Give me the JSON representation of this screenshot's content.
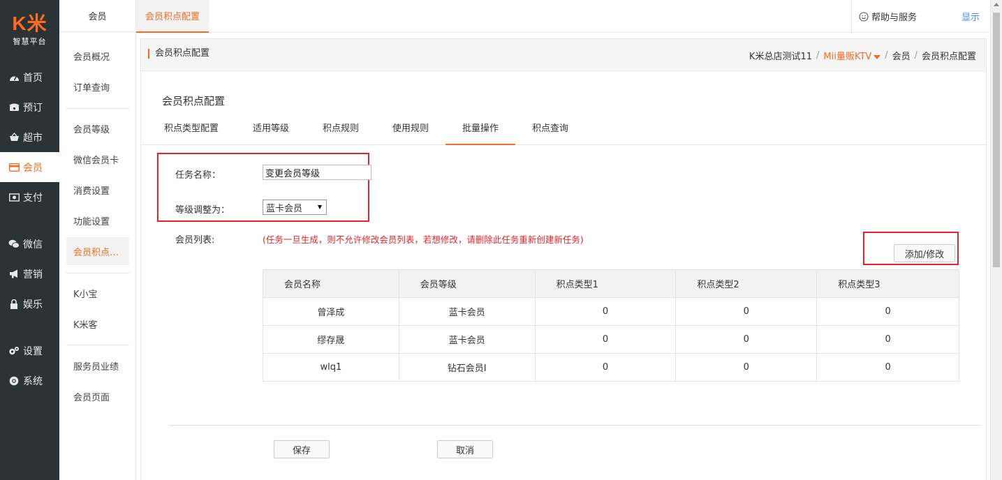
{
  "logo": {
    "mark": "K米",
    "sub": "智慧平台"
  },
  "main_nav": [
    {
      "label": "首页",
      "icon": "dashboard-icon"
    },
    {
      "label": "预订",
      "icon": "phone-icon"
    },
    {
      "label": "超市",
      "icon": "basket-icon"
    },
    {
      "label": "会员",
      "icon": "card-icon",
      "active": true
    },
    {
      "label": "支付",
      "icon": "money-icon"
    },
    {
      "label": "微信",
      "icon": "wechat-icon"
    },
    {
      "label": "营销",
      "icon": "megaphone-icon"
    },
    {
      "label": "娱乐",
      "icon": "lock-icon"
    },
    {
      "label": "设置",
      "icon": "gears-icon"
    },
    {
      "label": "系统",
      "icon": "chrome-icon"
    }
  ],
  "sub_nav": {
    "header": "会员",
    "items": [
      "会员概况",
      "订单查询",
      "会员等级",
      "微信会员卡",
      "消费设置",
      "功能设置",
      "会员积点…",
      "K小宝",
      "K米客",
      "服务员业绩",
      "会员页面"
    ]
  },
  "topbar": {
    "active_tab": "会员积点配置",
    "help": "帮助与服务",
    "show": "显示"
  },
  "breadcrumb": {
    "title": "会员积点配置",
    "items": [
      "K米总店测试11",
      "Mii量贩KTV",
      "会员",
      "会员积点配置"
    ]
  },
  "section_title": "会员积点配置",
  "tabs": [
    "积点类型配置",
    "适用等级",
    "积点规则",
    "使用规则",
    "批量操作",
    "积点查询"
  ],
  "form": {
    "task_label": "任务名称：",
    "task_value": "变更会员等级",
    "level_label": "等级调整为：",
    "level_value": "蓝卡会员",
    "members_label": "会员列表:",
    "notice": "(任务一旦生成，则不允许修改会员列表，若想修改，请删除此任务重新创建新任务)",
    "add_button": "添加/修改"
  },
  "table": {
    "headers": [
      "会员名称",
      "会员等级",
      "积点类型1",
      "积点类型2",
      "积点类型3"
    ],
    "rows": [
      [
        "曾泽成",
        "蓝卡会员",
        "0",
        "0",
        "0"
      ],
      [
        "缪存晟",
        "蓝卡会员",
        "0",
        "0",
        "0"
      ],
      [
        "wlq1",
        "钻石会员I",
        "0",
        "0",
        "0"
      ]
    ]
  },
  "footer": {
    "save": "保存",
    "cancel": "取消"
  },
  "colors": {
    "accent": "#f26c21",
    "highlight_red": "#e0262c",
    "nav_bg": "#2c3337"
  }
}
